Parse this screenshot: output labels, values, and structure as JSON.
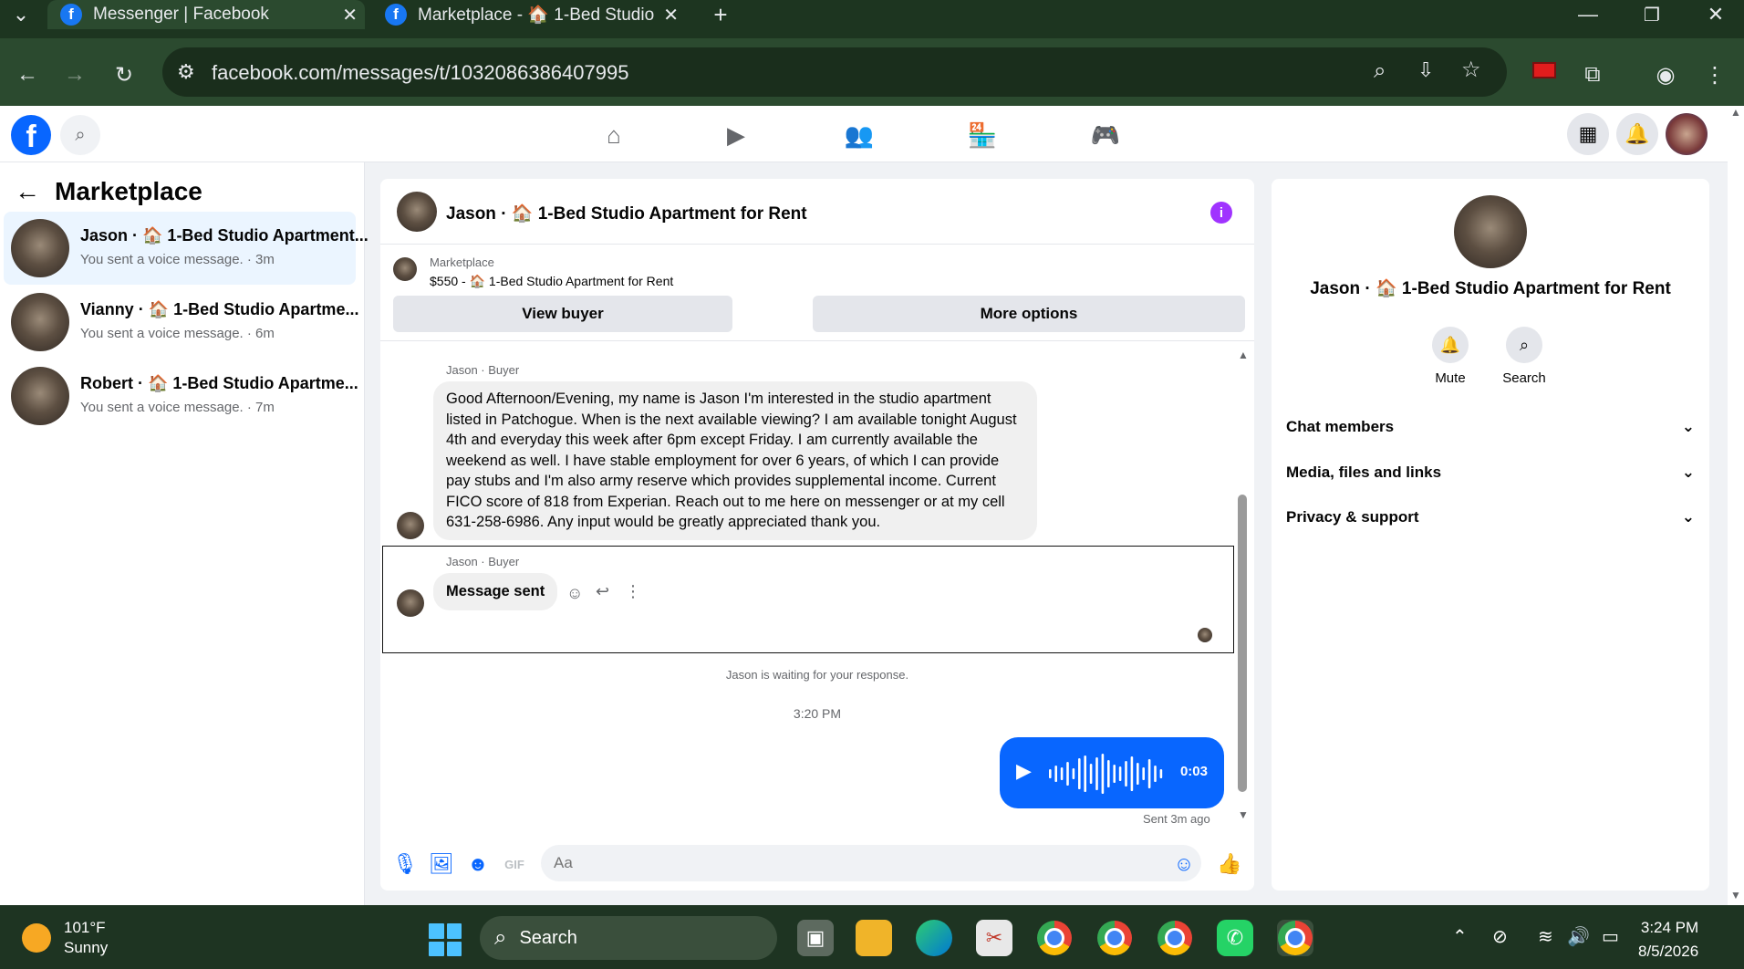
{
  "browser": {
    "tabs": [
      {
        "title": "Messenger | Facebook"
      },
      {
        "title": "Marketplace - 🏠 1-Bed Studio"
      }
    ],
    "url": "facebook.com/messages/t/1032086386407995"
  },
  "left_panel": {
    "title": "Marketplace",
    "conversations": [
      {
        "name": "Jason · 🏠 1-Bed Studio Apartment...",
        "preview": "You sent a voice message. · 3m"
      },
      {
        "name": "Vianny · 🏠 1-Bed Studio Apartme...",
        "preview": "You sent a voice message. · 6m"
      },
      {
        "name": "Robert · 🏠 1-Bed Studio Apartme...",
        "preview": "You sent a voice message. · 7m"
      }
    ]
  },
  "chat": {
    "title": "Jason · 🏠 1-Bed Studio Apartment for Rent",
    "marketplace_label": "Marketplace",
    "listing": "$550 - 🏠 1-Bed Studio Apartment for Rent",
    "view_buyer": "View buyer",
    "more_options": "More options",
    "sender_label_1": "Jason · Buyer",
    "message_1": "Good Afternoon/Evening, my name is Jason I'm interested in the studio apartment listed in Patchogue. When is the next available viewing? I am available tonight August 4th and everyday this week after 6pm except Friday. I am currently available the weekend as well. I have stable employment for over 6 years, of which I can provide pay stubs and I'm also army reserve which provides supplemental income. Current FICO score of 818 from Experian. Reach out to me here on messenger or at my cell 631-258-6986. Any input would be greatly appreciated thank you.",
    "sender_label_2": "Jason · Buyer",
    "message_2": "Message sent",
    "waiting_note": "Jason is waiting for your response.",
    "timestamp": "3:20 PM",
    "voice_duration": "0:03",
    "sent_status": "Sent 3m ago",
    "input_placeholder": "Aa"
  },
  "right_panel": {
    "name": "Jason · 🏠 1-Bed Studio Apartment for Rent",
    "mute": "Mute",
    "search": "Search",
    "sections": [
      "Chat members",
      "Media, files and links",
      "Privacy & support"
    ]
  },
  "taskbar": {
    "temperature": "101°F",
    "condition": "Sunny",
    "search": "Search",
    "time": "3:24 PM",
    "date": "8/5/2026"
  },
  "colors": {
    "accent": "#0866ff",
    "info": "#a033ff",
    "chrome_frame": "#2b4a2f"
  }
}
